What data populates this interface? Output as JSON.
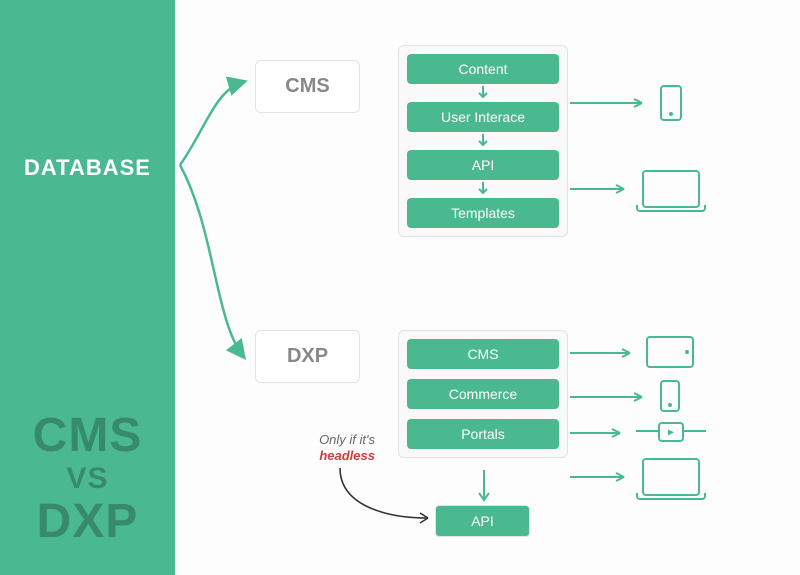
{
  "colors": {
    "accent": "#4ab990",
    "headless": "#d23c3c"
  },
  "sidebar": {
    "database_label": "DATABASE",
    "title_top": "CMS",
    "title_mid": "VS",
    "title_bottom": "DXP"
  },
  "cms": {
    "label": "CMS",
    "stack": [
      "Content",
      "User Interace",
      "API",
      "Templates"
    ]
  },
  "dxp": {
    "label": "DXP",
    "stack": [
      "CMS",
      "Commerce",
      "Portals"
    ],
    "api_label": "API",
    "annotation_prefix": "Only if it's",
    "annotation_highlight": "headless"
  },
  "devices": {
    "cms": [
      "phone",
      "laptop"
    ],
    "dxp": [
      "tablet",
      "phone",
      "watch",
      "laptop"
    ]
  }
}
